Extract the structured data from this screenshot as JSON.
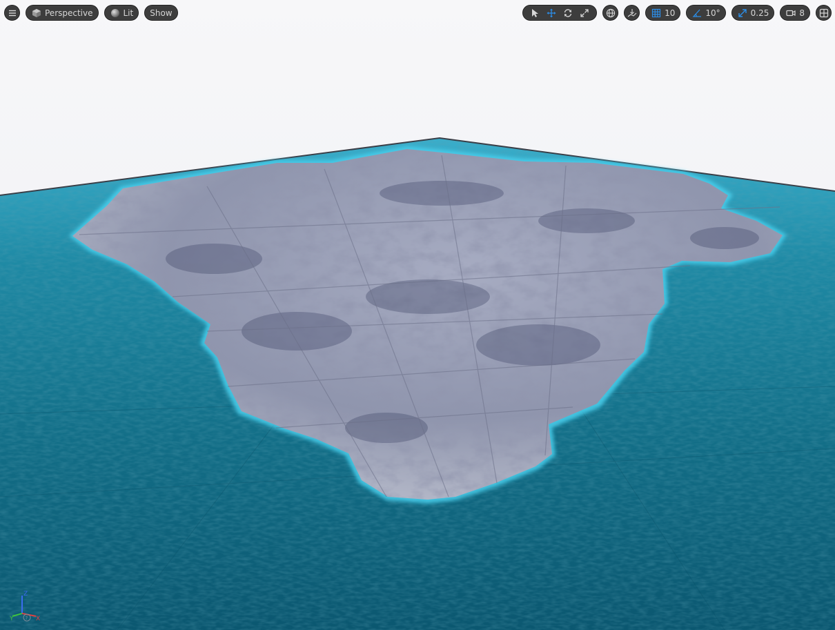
{
  "viewport": {
    "menu_icon": "hamburger-menu-icon",
    "view_mode_label": "Perspective",
    "lighting_label": "Lit",
    "show_label": "Show"
  },
  "toolbar": {
    "select_icon": "cursor-select-icon",
    "translate_icon": "move-arrows-icon",
    "rotate_icon": "rotate-icon",
    "scale_icon": "scale-icon",
    "world_icon": "globe-icon",
    "surface_snap_icon": "surface-snap-icon",
    "grid_snap_value": "10",
    "rotation_snap_value": "10°",
    "scale_snap_value": "0.25",
    "camera_speed_value": "8",
    "layout_icon": "viewport-layout-icon"
  },
  "gizmo": {
    "z_label": "Z",
    "y_label": "Y",
    "x_label": "X"
  },
  "colors": {
    "toolbar_bg": "#3d3d3d",
    "accent_blue": "#2c8ee8",
    "sky": "#f2f3f6",
    "ocean": "#0f6a83",
    "terrain": "#8f96b0",
    "shore": "#3fb8d8"
  }
}
